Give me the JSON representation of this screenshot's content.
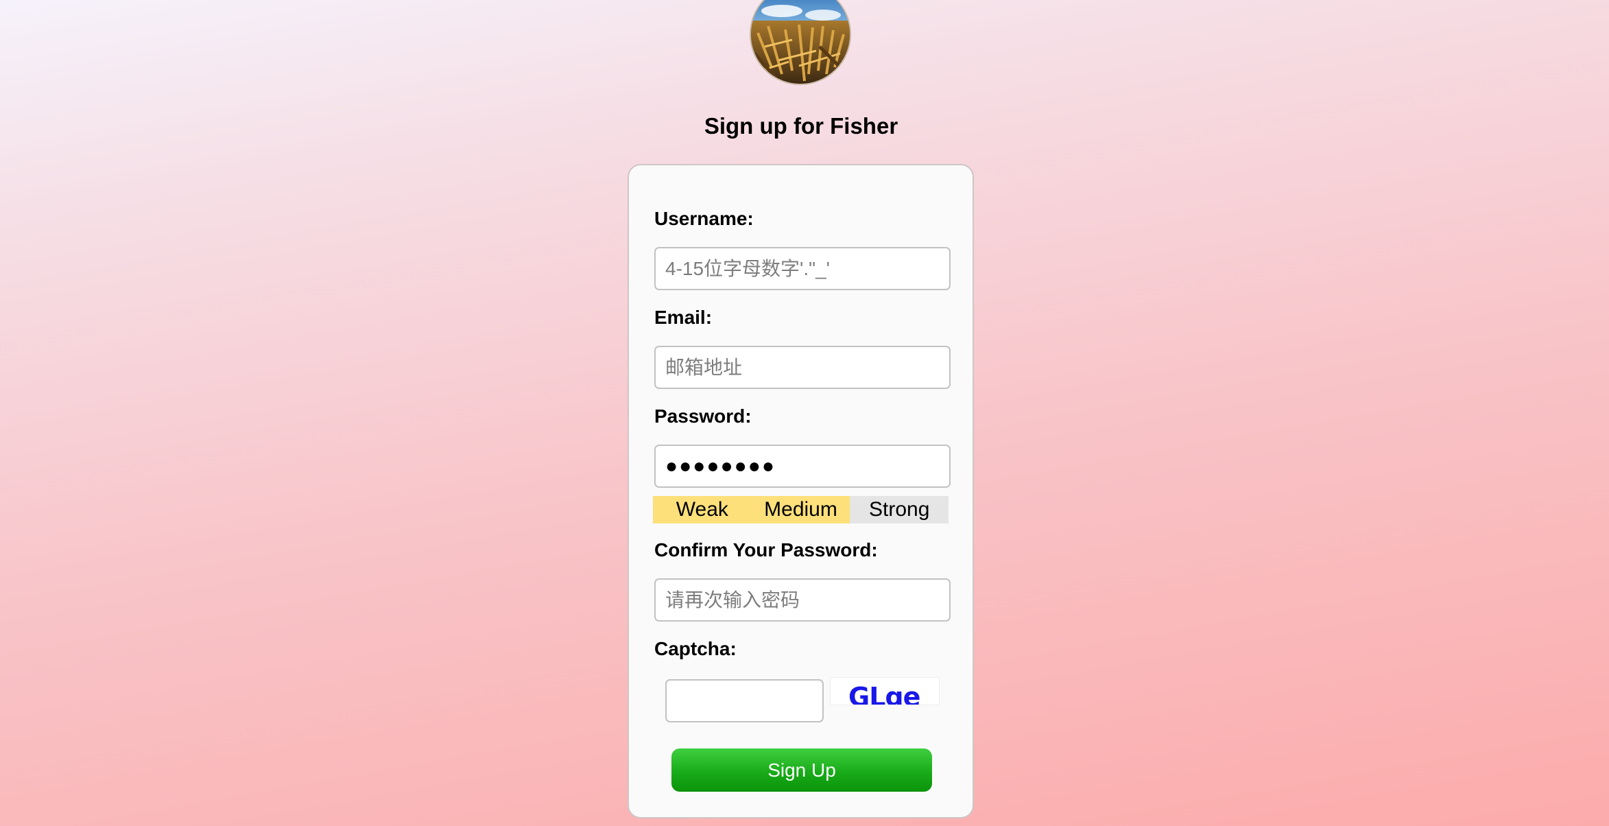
{
  "header": {
    "title": "Sign up for Fisher"
  },
  "form": {
    "username": {
      "label": "Username:",
      "placeholder": "4-15位字母数字'.\"_'"
    },
    "email": {
      "label": "Email:",
      "placeholder": "邮箱地址"
    },
    "password": {
      "label": "Password:",
      "value": "●●●●●●●●",
      "strength_levels": [
        "Weak",
        "Medium",
        "Strong"
      ],
      "strength_level": 2
    },
    "confirm_password": {
      "label": "Confirm Your Password:",
      "placeholder": "请再次输入密码"
    },
    "captcha": {
      "label": "Captcha:",
      "value": "",
      "image_text": "GLge"
    },
    "submit_label": "Sign Up"
  },
  "colors": {
    "strength_active": "#fde07a",
    "strength_inactive": "#e5e5e5",
    "button": "#1aaa1a",
    "captcha_text": "#1818e8"
  }
}
